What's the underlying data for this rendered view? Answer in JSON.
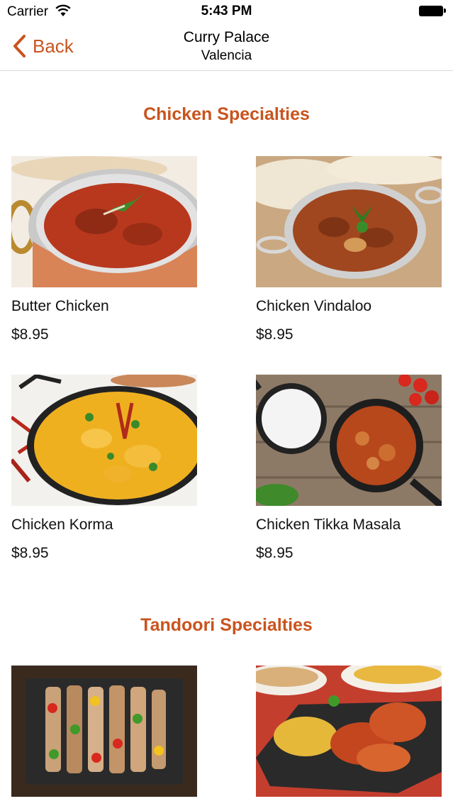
{
  "status_bar": {
    "carrier": "Carrier",
    "time": "5:43 PM"
  },
  "nav": {
    "back_label": "Back",
    "title": "Curry Palace",
    "subtitle": "Valencia"
  },
  "sections": [
    {
      "title": "Chicken Specialties",
      "items": [
        {
          "name": "Butter Chicken",
          "price": "$8.95"
        },
        {
          "name": "Chicken Vindaloo",
          "price": "$8.95"
        },
        {
          "name": "Chicken Korma",
          "price": "$8.95"
        },
        {
          "name": "Chicken Tikka Masala",
          "price": "$8.95"
        }
      ]
    },
    {
      "title": "Tandoori Specialties",
      "items": [
        {
          "name": "",
          "price": ""
        },
        {
          "name": "",
          "price": ""
        }
      ]
    }
  ],
  "colors": {
    "accent": "#c9541e"
  }
}
